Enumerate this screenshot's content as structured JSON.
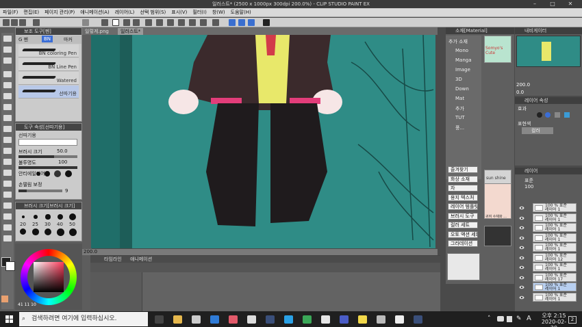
{
  "window": {
    "title": "일러스트* (2500 x 1000px 300dpi 200.0%) - CLIP STUDIO PAINT EX"
  },
  "menu": [
    "파일(F)",
    "편집(E)",
    "페이지 관리(P)",
    "애니메이션(A)",
    "레이어(L)",
    "선택 범위(S)",
    "표시(V)",
    "필터(I)",
    "창(W)",
    "도움말(H)"
  ],
  "sub_tool_panel": {
    "title": "보조 도구[펜]",
    "tabs": [
      "BN",
      "G 펜",
      "마커"
    ],
    "brushes": [
      "BN coloring Pen",
      "BN Line Pen",
      "Watered",
      "선따기용"
    ]
  },
  "tool_property": {
    "title": "도구 속성[선따기용]",
    "name": "선따기용",
    "rows": [
      {
        "label": "브러시 크기",
        "value": "50.0"
      },
      {
        "label": "불투명도",
        "value": "100"
      },
      {
        "label": "안티에일리어싱",
        "value": ""
      },
      {
        "label": "손떨림 보정",
        "value": "9"
      }
    ],
    "brush_opacity": 100,
    "stabilization": 9
  },
  "brush_size_panel": {
    "title": "브러시 크기[브러시 크기]",
    "sizes": [
      "20",
      "25",
      "30",
      "40",
      "50"
    ]
  },
  "canvas_tabs": [
    "일렇게.png",
    "일러스트*"
  ],
  "canvas_status": {
    "zoom": "200.0"
  },
  "timeline": {
    "title": "타임라인",
    "tab2": "애니메이션"
  },
  "material": {
    "title": "소재[Material]",
    "tree": [
      "추가 소재",
      "Mono",
      "Manga",
      "Image",
      "3D",
      "Down",
      "Mat",
      "추가",
      "TUT",
      "풍..."
    ],
    "thumbs": [
      "Somyo's Cute",
      "sun shine",
      "귀여 수채화 ..."
    ],
    "quick_list": [
      "즐겨찾기",
      "화상 소재",
      "자",
      "용지 텍스처",
      "레이어 템플릿",
      "브러시 도구",
      "컬러 세트",
      "오토 액션 세트",
      "그라데이션"
    ]
  },
  "navigator": {
    "title": "내비게이터",
    "zoom": "200.0",
    "angle": "0.0"
  },
  "layer_property": {
    "title": "레이어 속성",
    "effect": "효과",
    "expression": "표현색",
    "expression_value": "컬러"
  },
  "layers": {
    "title": "레이어",
    "blend": "표준",
    "opacity": "100",
    "items": [
      {
        "pct": "100 % 표준",
        "name": "레이어 1"
      },
      {
        "pct": "100 % 표준",
        "name": "레이어 1"
      },
      {
        "pct": "100 % 표준",
        "name": "레이어 1"
      },
      {
        "pct": "100 % 표준",
        "name": "레이어 1"
      },
      {
        "pct": "100 % 표준",
        "name": "레이어 1"
      },
      {
        "pct": "100 % 표준",
        "name": "레이어 12"
      },
      {
        "pct": "100 % 표준",
        "name": "레이어 1"
      },
      {
        "pct": "100 % 표준",
        "name": "레이어 17"
      },
      {
        "pct": "100 % 표준",
        "name": "레이어 1"
      },
      {
        "pct": "100 % 표준",
        "name": "레이어 1"
      }
    ]
  },
  "color_wheel": {
    "values": [
      "41",
      "11",
      "10"
    ]
  },
  "taskbar": {
    "search_placeholder": "검색하려면 여기에 입력하십시오.",
    "time": "오후 2:15",
    "date": "2020-02-29",
    "notifications": "2",
    "ime": "A"
  },
  "colors": {
    "canvas_bg": "#2f8c86",
    "taskbar": "#1f1f1f",
    "ui_dark": "#5b5b5b"
  }
}
